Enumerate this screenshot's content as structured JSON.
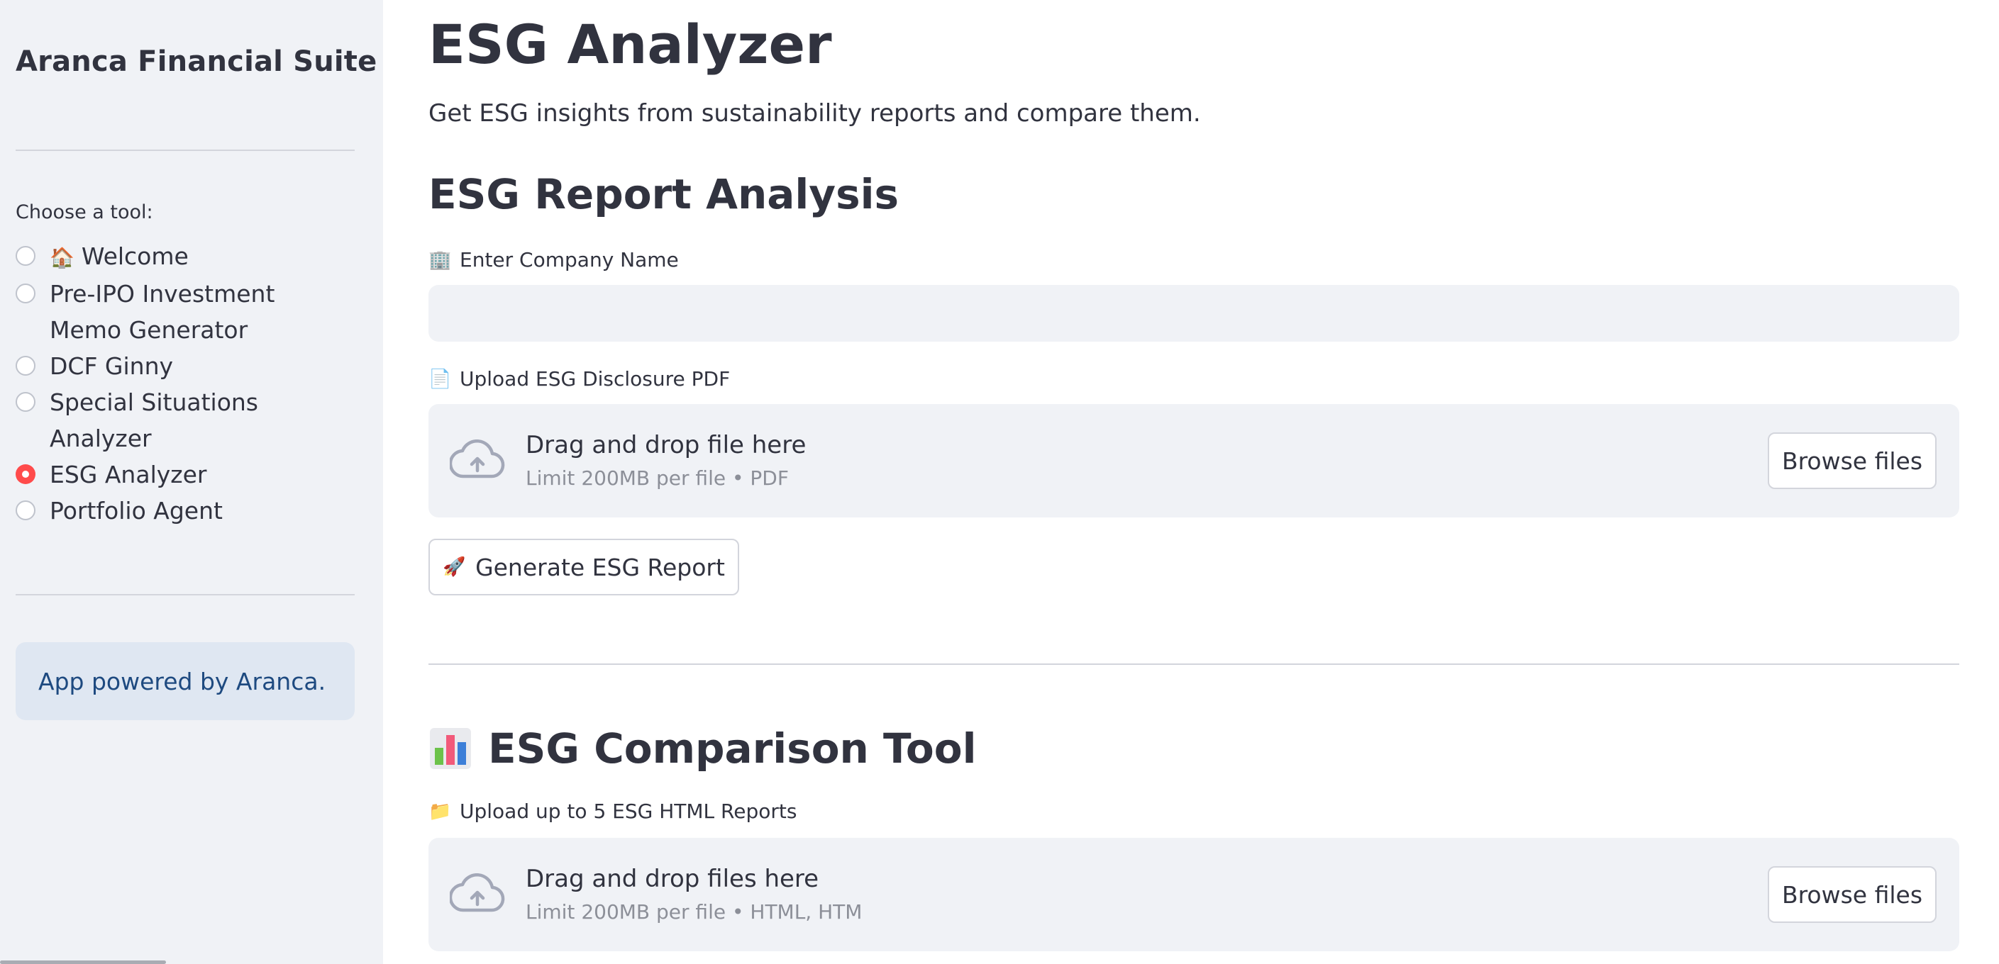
{
  "sidebar": {
    "title": "Aranca Financial Suite",
    "radio_caption": "Choose a tool:",
    "options": [
      {
        "label": "Welcome",
        "emoji": "🏠",
        "checked": false
      },
      {
        "label": "Pre-IPO Investment Memo Generator",
        "checked": false
      },
      {
        "label": "DCF Ginny",
        "checked": false
      },
      {
        "label": "Special Situations Analyzer",
        "checked": false
      },
      {
        "label": "ESG Analyzer",
        "checked": true
      },
      {
        "label": "Portfolio Agent",
        "checked": false
      }
    ],
    "info_text": "App powered by Aranca."
  },
  "main": {
    "title": "ESG Analyzer",
    "description": "Get ESG insights from sustainability reports and compare them.",
    "report_section": {
      "title": "ESG Report Analysis",
      "company_label": "Enter Company Name",
      "company_label_emoji": "🏢",
      "company_value": "",
      "upload_label": "Upload ESG Disclosure PDF",
      "upload_label_emoji": "📄",
      "dropzone_main": "Drag and drop file here",
      "dropzone_sub": "Limit 200MB per file • PDF",
      "browse_label": "Browse files",
      "generate_label": "Generate ESG Report",
      "generate_emoji": "🚀"
    },
    "comparison_section": {
      "title": "ESG Comparison Tool",
      "title_icon": "bar-chart-icon",
      "upload_label": "Upload up to 5 ESG HTML Reports",
      "upload_label_emoji": "📁",
      "dropzone_main": "Drag and drop files here",
      "dropzone_sub": "Limit 200MB per file • HTML, HTM",
      "browse_label": "Browse files"
    }
  },
  "colors": {
    "accent": "#ff4b4b",
    "sidebar_bg": "#f0f2f6",
    "info_bg": "#dfe7f2",
    "info_text": "#1e4a80",
    "text": "#31333f",
    "muted": "#8c8f98"
  }
}
